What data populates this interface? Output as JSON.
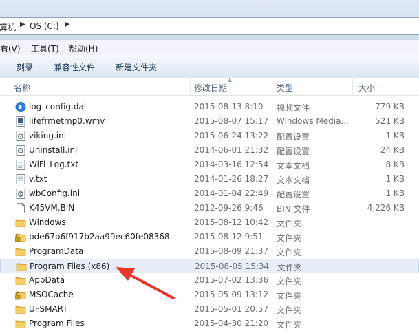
{
  "address": {
    "crumbs": [
      "算机",
      "OS (C:)"
    ]
  },
  "menu": {
    "items": [
      "看(V)",
      "工具(T)",
      "帮助(H)"
    ]
  },
  "toolbar": {
    "burn": "刻录",
    "compat": "兼容性文件",
    "new_folder": "新建文件夹"
  },
  "columns": {
    "name": "名称",
    "date": "修改日期",
    "type": "类型",
    "size": "大小"
  },
  "files": [
    {
      "name": "log_config.dat",
      "date": "2015-08-13 8:10",
      "type": "视频文件",
      "size": "779 KB",
      "icon": "media-file-icon"
    },
    {
      "name": "lifefrmetmp0.wmv",
      "date": "2015-08-07 15:17",
      "type": "Windows Media...",
      "size": "521 KB",
      "icon": "video-file-icon"
    },
    {
      "name": "viking.ini",
      "date": "2015-06-24 13:22",
      "type": "配置设置",
      "size": "1 KB",
      "icon": "settings-file-icon"
    },
    {
      "name": "Uninstall.ini",
      "date": "2014-06-01 21:32",
      "type": "配置设置",
      "size": "24 KB",
      "icon": "settings-file-icon"
    },
    {
      "name": "WiFi_Log.txt",
      "date": "2014-03-16 12:54",
      "type": "文本文档",
      "size": "8 KB",
      "icon": "text-file-icon"
    },
    {
      "name": "v.txt",
      "date": "2014-01-26 18:27",
      "type": "文本文档",
      "size": "1 KB",
      "icon": "text-file-icon"
    },
    {
      "name": "wbConfig.ini",
      "date": "2014-01-04 22:49",
      "type": "配置设置",
      "size": "1 KB",
      "icon": "settings-file-icon"
    },
    {
      "name": "K45VM.BIN",
      "date": "2012-09-26 9:46",
      "type": "BIN 文件",
      "size": "4,226 KB",
      "icon": "blank-file-icon"
    },
    {
      "name": "Windows",
      "date": "2015-08-12 10:42",
      "type": "文件夹",
      "size": "",
      "icon": "folder-icon"
    },
    {
      "name": "bde67b6f917b2aa99ec60fe08368",
      "date": "2015-08-12 9:51",
      "type": "文件夹",
      "size": "",
      "icon": "locked-folder-icon"
    },
    {
      "name": "ProgramData",
      "date": "2015-08-09 21:37",
      "type": "文件夹",
      "size": "",
      "icon": "folder-icon"
    },
    {
      "name": "Program Files (x86)",
      "date": "2015-08-05 15:34",
      "type": "文件夹",
      "size": "",
      "icon": "folder-icon",
      "selected": true
    },
    {
      "name": "AppData",
      "date": "2015-07-02 13:36",
      "type": "文件夹",
      "size": "",
      "icon": "folder-icon"
    },
    {
      "name": "MSOCache",
      "date": "2015-05-09 13:12",
      "type": "文件夹",
      "size": "",
      "icon": "locked-folder-icon"
    },
    {
      "name": "UFSMART",
      "date": "2015-05-01 20:57",
      "type": "文件夹",
      "size": "",
      "icon": "folder-icon"
    },
    {
      "name": "Program Files",
      "date": "2015-04-30 21:20",
      "type": "文件夹",
      "size": "",
      "icon": "folder-icon"
    }
  ],
  "colors": {
    "arrow": "#e8352b",
    "folder": "#f0c14b",
    "selection": "#e8eef7"
  }
}
